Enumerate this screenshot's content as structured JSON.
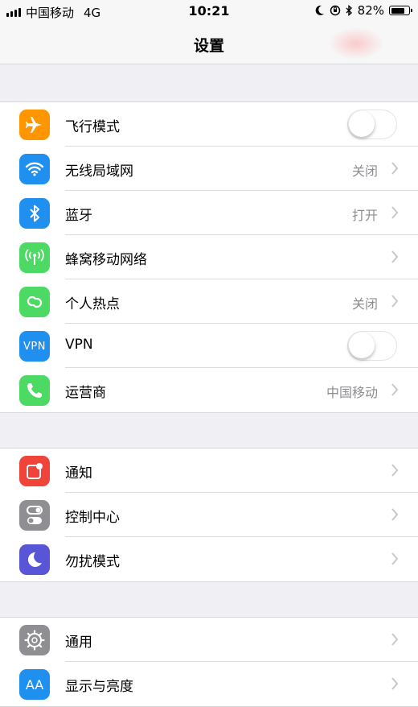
{
  "status_bar": {
    "carrier": "中国移动",
    "network": "4G",
    "time": "10:21",
    "battery": "82%",
    "battery_level": 0.82
  },
  "nav": {
    "title": "设置"
  },
  "groups": [
    {
      "items": [
        {
          "label": "飞行模式",
          "icon": "airplane-icon",
          "color": "#ff9500",
          "control": "toggle",
          "toggle_on": false
        },
        {
          "label": "无线局域网",
          "icon": "wifi-icon",
          "color": "#1f8ff0",
          "value": "关闭",
          "control": "chevron"
        },
        {
          "label": "蓝牙",
          "icon": "bluetooth-icon",
          "color": "#1f8ff0",
          "value": "打开",
          "control": "chevron"
        },
        {
          "label": "蜂窝移动网络",
          "icon": "cellular-icon",
          "color": "#4cd964",
          "value": "",
          "control": "chevron"
        },
        {
          "label": "个人热点",
          "icon": "hotspot-icon",
          "color": "#4cd964",
          "value": "关闭",
          "control": "chevron"
        },
        {
          "label": "VPN",
          "icon": "vpn-icon",
          "icon_text": "VPN",
          "color": "#1f8ff0",
          "control": "toggle",
          "toggle_on": false
        },
        {
          "label": "运营商",
          "icon": "phone-icon",
          "color": "#4cd964",
          "value": "中国移动",
          "control": "chevron"
        }
      ]
    },
    {
      "items": [
        {
          "label": "通知",
          "icon": "notifications-icon",
          "color": "#f0433a",
          "control": "chevron"
        },
        {
          "label": "控制中心",
          "icon": "control-center-icon",
          "color": "#8e8e93",
          "control": "chevron"
        },
        {
          "label": "勿扰模式",
          "icon": "moon-icon",
          "color": "#5856d6",
          "control": "chevron"
        }
      ]
    },
    {
      "items": [
        {
          "label": "通用",
          "icon": "gear-icon",
          "color": "#8e8e93",
          "control": "chevron"
        },
        {
          "label": "显示与亮度",
          "icon": "display-brightness-icon",
          "icon_text": "AA",
          "color": "#1f8ff0",
          "control": "chevron"
        }
      ]
    }
  ]
}
